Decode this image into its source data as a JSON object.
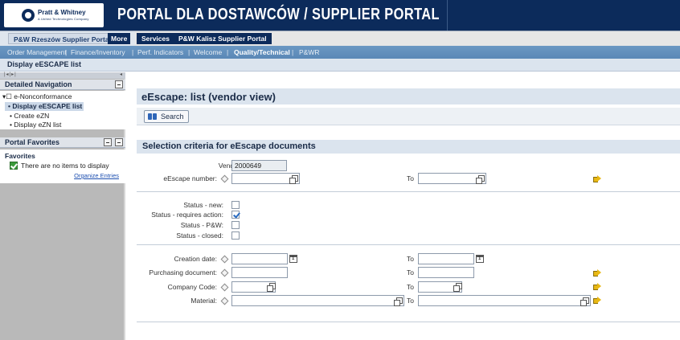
{
  "header": {
    "logo_name": "Pratt & Whitney",
    "logo_sub": "A United Technologies Company",
    "portal_title": "PORTAL DLA DOSTAWCÓW / SUPPLIER PORTAL"
  },
  "top_tabs": {
    "active": "P&W Rzeszów Supplier Portal",
    "more": "More",
    "services": "Services",
    "kalisz": "P&W Kalisz Supplier Portal"
  },
  "sub_nav": {
    "items": [
      "Order Management",
      "Finance/Inventory",
      "Perf. Indicators",
      "Welcome",
      "Quality/Technical",
      "P&WR"
    ],
    "separator": "|",
    "active_index": 4
  },
  "page_title": "Display eESCAPE list",
  "left_panel": {
    "grip": "|◂|▸|",
    "grip_right": "◂",
    "detailed_nav_title": "Detailed Navigation",
    "nav_root": "▾☐ e-Nonconformance",
    "nav_items": [
      "Display eESCAPE list",
      "Create eZN",
      "Display eZN list"
    ],
    "selected_index": 0,
    "portal_favorites_title": "Portal Favorites",
    "favorites_heading": "Favorites",
    "favorites_empty": "There are no items to display",
    "organize_link": "Organize Entries"
  },
  "content": {
    "title": "eEscape: list (vendor view)",
    "search_label": "Search",
    "selection_title": "Selection criteria for eEscape documents",
    "vendor_label": "Vendor:",
    "vendor_value": "2000649",
    "escape_number_label": "eEscape number:",
    "to_label": "To",
    "status_new_label": "Status - new:",
    "status_action_label": "Status - requires action:",
    "status_pw_label": "Status - P&W:",
    "status_closed_label": "Status - closed:",
    "status_checked": [
      false,
      true,
      false,
      false
    ],
    "creation_date_label": "Creation date:",
    "purchasing_doc_label": "Purchasing document:",
    "company_code_label": "Company Code:",
    "material_label": "Material:"
  },
  "colors": {
    "header_bg": "#0c2b5b",
    "subnav_bg": "#6b98c3",
    "section_bg": "#dbe4ee",
    "left_panel_bg": "#b9b9b9"
  }
}
